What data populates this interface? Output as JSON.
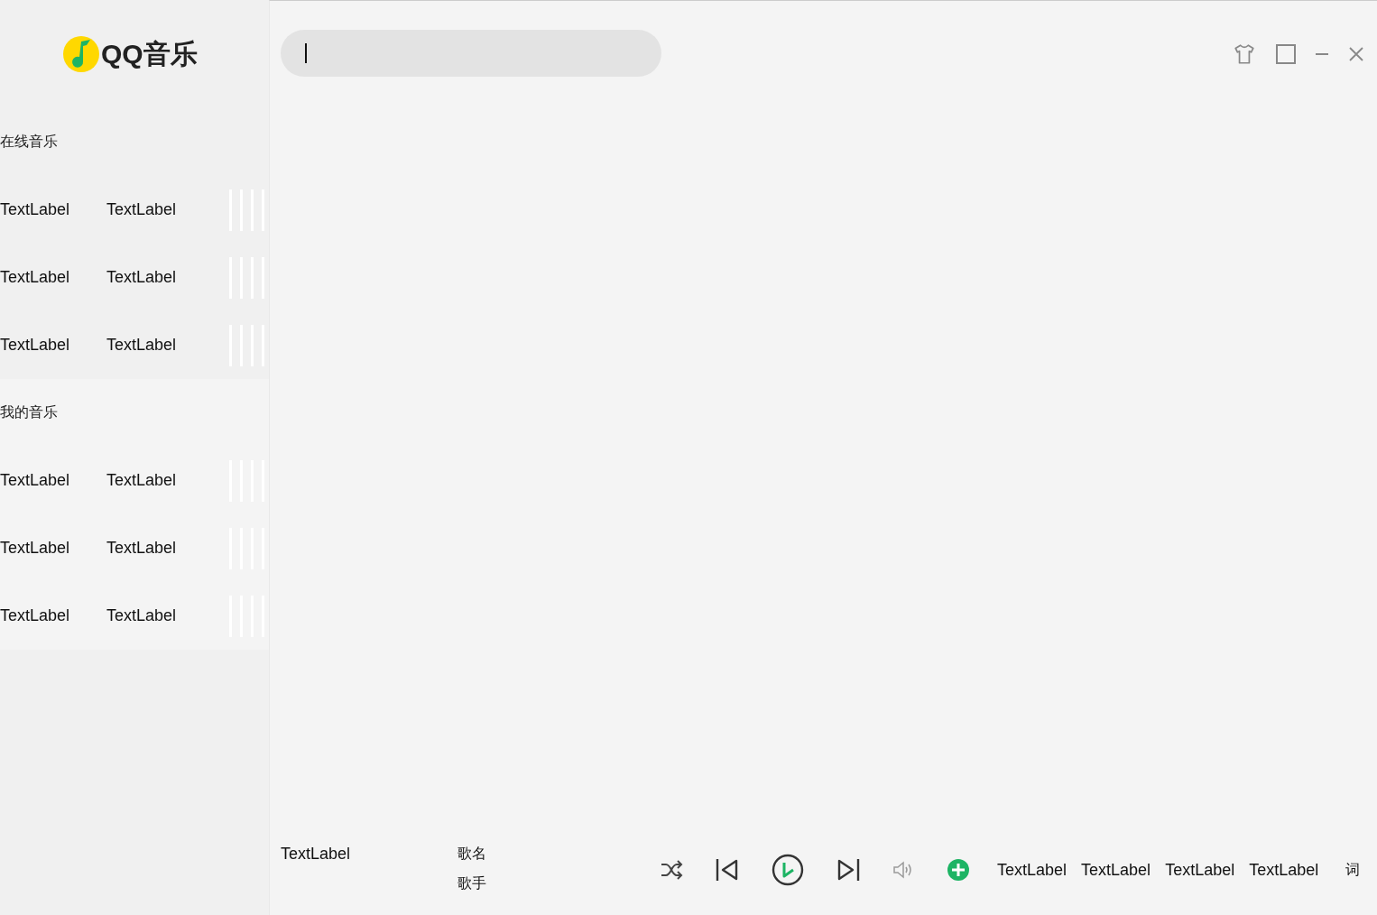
{
  "sidebar": {
    "logo": "QQ音乐",
    "sections": [
      {
        "title": "在线音乐",
        "rows": [
          {
            "left": "TextLabel",
            "right": "TextLabel"
          },
          {
            "left": "TextLabel",
            "right": "TextLabel"
          },
          {
            "left": "TextLabel",
            "right": "TextLabel"
          }
        ]
      },
      {
        "title": "我的音乐",
        "rows": [
          {
            "left": "TextLabel",
            "right": "TextLabel"
          },
          {
            "left": "TextLabel",
            "right": "TextLabel"
          },
          {
            "left": "TextLabel",
            "right": "TextLabel"
          }
        ]
      }
    ]
  },
  "player": {
    "cover_label": "TextLabel",
    "song_name": "歌名",
    "singer": "歌手",
    "labels": [
      "TextLabel",
      "TextLabel",
      "TextLabel",
      "TextLabel"
    ],
    "lyrics": "词"
  }
}
